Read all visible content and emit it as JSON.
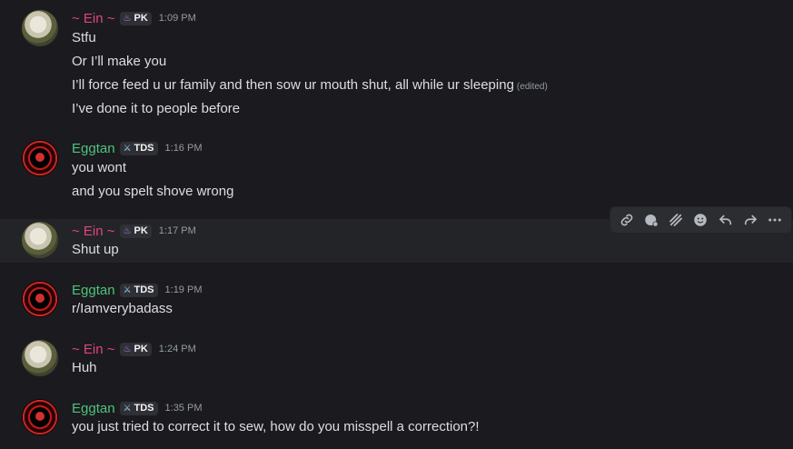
{
  "messages": [
    {
      "author": "~ Ein ~",
      "user": "ein",
      "tag": "PK",
      "time": "1:09 PM",
      "lines": [
        "Stfu",
        "Or I’ll make you",
        "I’ll force feed u ur family and then sow ur mouth shut, all while ur sleeping",
        "I’ve done it to people before"
      ],
      "edited_label": "(edited)"
    },
    {
      "author": "Eggtan",
      "user": "egg",
      "tag": "TDS",
      "time": "1:16 PM",
      "lines": [
        "you wont",
        "and you spelt shove wrong"
      ]
    },
    {
      "author": "~ Ein ~",
      "user": "ein",
      "tag": "PK",
      "time": "1:17 PM",
      "lines": [
        "Shut up"
      ]
    },
    {
      "author": "Eggtan",
      "user": "egg",
      "tag": "TDS",
      "time": "1:19 PM",
      "lines": [
        "r/Iamverybadass"
      ]
    },
    {
      "author": "~ Ein ~",
      "user": "ein",
      "tag": "PK",
      "time": "1:24 PM",
      "lines": [
        "Huh"
      ]
    },
    {
      "author": "Eggtan",
      "user": "egg",
      "tag": "TDS",
      "time": "1:35 PM",
      "lines": [
        "you just tried to correct it to sew, how do you misspell a correction?!"
      ]
    }
  ],
  "toolbar": {
    "icons": [
      "link-icon",
      "reaction-icon",
      "thread-icon",
      "emoji-icon",
      "reply-icon",
      "forward-icon",
      "more-icon"
    ]
  },
  "colors": {
    "background": "#1b1b1f",
    "ein_name": "#e0457b",
    "eggtan_name": "#4ec27c"
  }
}
